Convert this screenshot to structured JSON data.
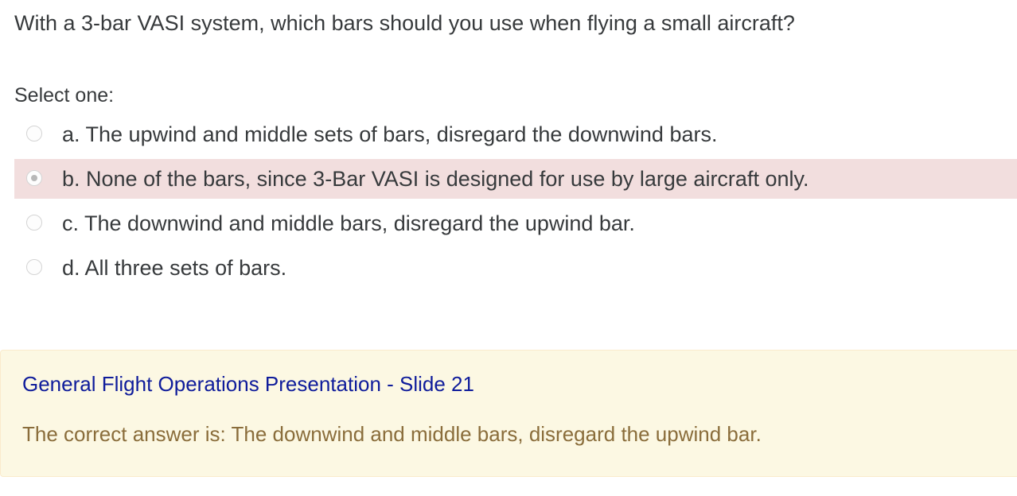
{
  "question": {
    "text": "With a 3-bar VASI system, which bars should you use when flying a small aircraft?",
    "prompt": "Select one:"
  },
  "answers": [
    {
      "label": "a. The upwind and middle sets of bars, disregard the downwind bars.",
      "selected": false
    },
    {
      "label": "b. None of the bars, since 3-Bar VASI is designed for use by large aircraft only.",
      "selected": true
    },
    {
      "label": "c. The downwind and middle bars, disregard the upwind bar.",
      "selected": false
    },
    {
      "label": "d. All three sets of bars.",
      "selected": false
    }
  ],
  "feedback": {
    "reference_link": "General Flight Operations Presentation - Slide 21",
    "correct_answer": "The correct answer is: The downwind and middle bars, disregard the upwind bar."
  },
  "colors": {
    "selected_background": "#f2dede",
    "feedback_background": "#fcf8e3",
    "link": "#0f1c9b",
    "feedback_text": "#8a6d3b"
  }
}
